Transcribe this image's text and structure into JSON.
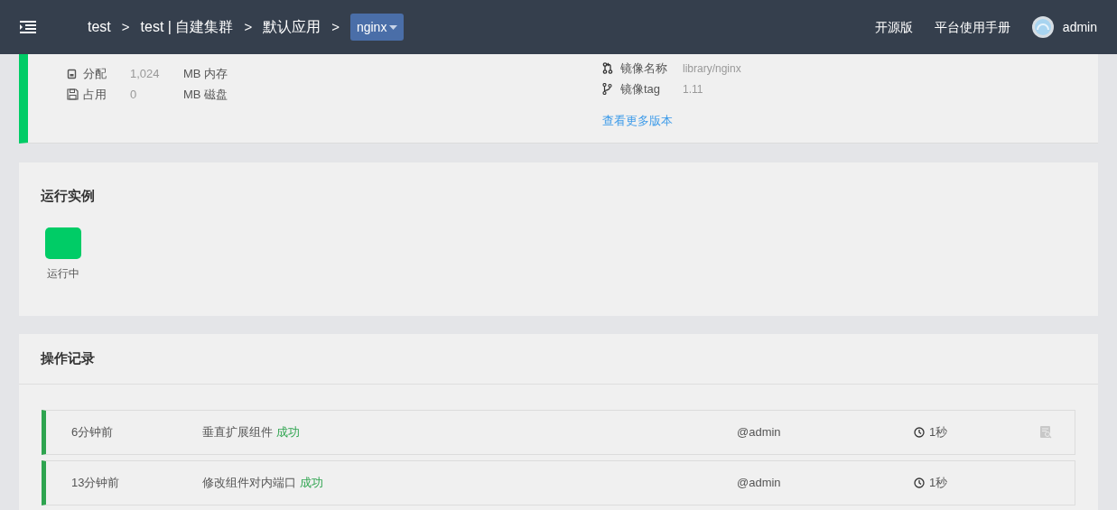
{
  "header": {
    "breadcrumbs": [
      "test",
      "test | 自建集群",
      "默认应用"
    ],
    "separator": ">",
    "current_app": "nginx",
    "links": [
      "开源版",
      "平台使用手册"
    ],
    "user": "admin"
  },
  "overview": {
    "resources": [
      {
        "kind": "memory",
        "label": "分配",
        "value": "1,024",
        "unit": "MB 内存"
      },
      {
        "kind": "disk",
        "label": "占用",
        "value": "0",
        "unit": "MB 磁盘"
      }
    ],
    "image": [
      {
        "kind": "name",
        "label": "镜像名称",
        "value": "library/nginx"
      },
      {
        "kind": "tag",
        "label": "镜像tag",
        "value": "1.11"
      }
    ],
    "more_link": "查看更多版本"
  },
  "instances": {
    "title": "运行实例",
    "items": [
      {
        "label": "运行中",
        "color": "#00cc66"
      }
    ]
  },
  "records": {
    "title": "操作记录",
    "rows": [
      {
        "time": "6分钟前",
        "action": "垂直扩展组件",
        "result": "成功",
        "user": "@admin",
        "duration": "1秒",
        "has_log": true
      },
      {
        "time": "13分钟前",
        "action": "修改组件对内端口",
        "result": "成功",
        "user": "@admin",
        "duration": "1秒",
        "has_log": false
      }
    ]
  }
}
